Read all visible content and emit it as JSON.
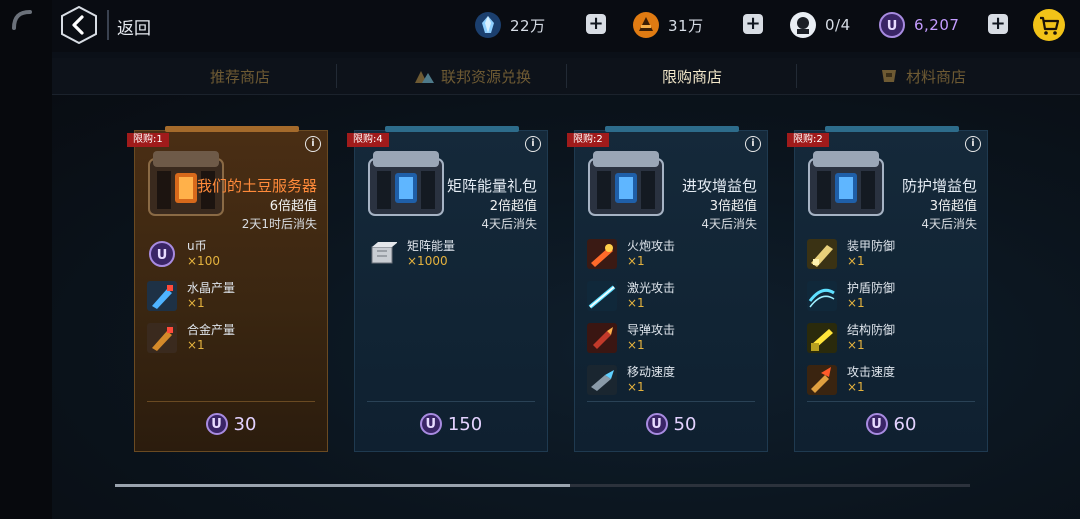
{
  "header": {
    "back_label": "返回",
    "resources": {
      "crystal": {
        "value": "22万",
        "icon": "crystal-icon"
      },
      "alloy": {
        "value": "31万",
        "icon": "alloy-icon"
      },
      "stamina": {
        "value": "0/4",
        "icon": "pilot-icon"
      },
      "ucoin": {
        "value": "6,207",
        "icon": "u-coin-icon"
      }
    }
  },
  "tabs": [
    {
      "label": "推荐商店",
      "active": false
    },
    {
      "label": "联邦资源兑换",
      "active": false
    },
    {
      "label": "限购商店",
      "active": true
    },
    {
      "label": "材料商店",
      "active": false
    }
  ],
  "cards": [
    {
      "limit": "限购:1",
      "name": "我们的土豆服务器",
      "value": "6倍超值",
      "expire": "2天1时后消失",
      "items": [
        {
          "name": "u币",
          "qty": "×100",
          "icon": "u-coin-icon"
        },
        {
          "name": "水晶产量",
          "qty": "×1",
          "icon": "crystal-output-icon"
        },
        {
          "name": "合金产量",
          "qty": "×1",
          "icon": "alloy-output-icon"
        }
      ],
      "price": "30"
    },
    {
      "limit": "限购:4",
      "name": "矩阵能量礼包",
      "value": "2倍超值",
      "expire": "4天后消失",
      "items": [
        {
          "name": "矩阵能量",
          "qty": "×1000",
          "icon": "matrix-energy-icon"
        }
      ],
      "price": "150"
    },
    {
      "limit": "限购:2",
      "name": "进攻增益包",
      "value": "3倍超值",
      "expire": "4天后消失",
      "items": [
        {
          "name": "火炮攻击",
          "qty": "×1",
          "icon": "cannon-attack-icon"
        },
        {
          "name": "激光攻击",
          "qty": "×1",
          "icon": "laser-attack-icon"
        },
        {
          "name": "导弹攻击",
          "qty": "×1",
          "icon": "missile-attack-icon"
        },
        {
          "name": "移动速度",
          "qty": "×1",
          "icon": "move-speed-icon"
        }
      ],
      "price": "50"
    },
    {
      "limit": "限购:2",
      "name": "防护增益包",
      "value": "3倍超值",
      "expire": "4天后消失",
      "items": [
        {
          "name": "装甲防御",
          "qty": "×1",
          "icon": "armor-defense-icon"
        },
        {
          "name": "护盾防御",
          "qty": "×1",
          "icon": "shield-defense-icon"
        },
        {
          "name": "结构防御",
          "qty": "×1",
          "icon": "structure-defense-icon"
        },
        {
          "name": "攻击速度",
          "qty": "×1",
          "icon": "attack-speed-icon"
        }
      ],
      "price": "60"
    }
  ],
  "colors": {
    "accent_gold": "#e4b23e",
    "limit_red": "#a01b1b",
    "price_purple": "#a88be0"
  }
}
